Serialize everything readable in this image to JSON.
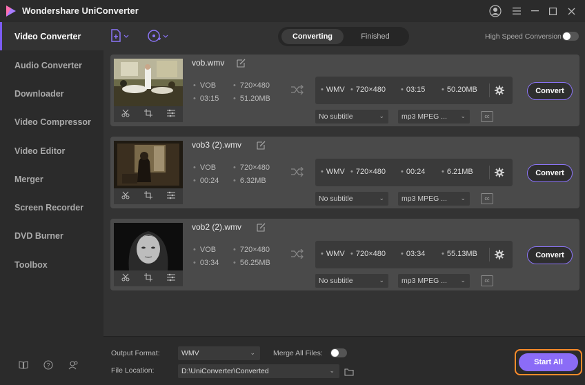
{
  "app": {
    "title": "Wondershare UniConverter"
  },
  "sidebar": {
    "items": [
      {
        "label": "Video Converter",
        "active": true
      },
      {
        "label": "Audio Converter"
      },
      {
        "label": "Downloader"
      },
      {
        "label": "Video Compressor"
      },
      {
        "label": "Video Editor"
      },
      {
        "label": "Merger"
      },
      {
        "label": "Screen Recorder"
      },
      {
        "label": "DVD Burner"
      },
      {
        "label": "Toolbox"
      }
    ]
  },
  "toolbar": {
    "tabs": [
      {
        "label": "Converting",
        "active": true
      },
      {
        "label": "Finished"
      }
    ],
    "high_speed_label": "High Speed Conversion",
    "high_speed_on": false
  },
  "files": [
    {
      "name": "vob.wmv",
      "src_format": "VOB",
      "src_res": "720×480",
      "src_duration": "03:15",
      "src_size": "51.20MB",
      "out_format": "WMV",
      "out_res": "720×480",
      "out_duration": "03:15",
      "out_size": "50.20MB",
      "subtitle": "No subtitle",
      "audio": "mp3 MPEG ...",
      "convert_label": "Convert"
    },
    {
      "name": "vob3 (2).wmv",
      "src_format": "VOB",
      "src_res": "720×480",
      "src_duration": "00:24",
      "src_size": "6.32MB",
      "out_format": "WMV",
      "out_res": "720×480",
      "out_duration": "00:24",
      "out_size": "6.21MB",
      "subtitle": "No subtitle",
      "audio": "mp3 MPEG ...",
      "convert_label": "Convert"
    },
    {
      "name": "vob2 (2).wmv",
      "src_format": "VOB",
      "src_res": "720×480",
      "src_duration": "03:34",
      "src_size": "56.25MB",
      "out_format": "WMV",
      "out_res": "720×480",
      "out_duration": "03:34",
      "out_size": "55.13MB",
      "subtitle": "No subtitle",
      "audio": "mp3 MPEG ...",
      "convert_label": "Convert"
    }
  ],
  "footer": {
    "output_format_label": "Output Format:",
    "output_format": "WMV",
    "merge_label": "Merge All Files:",
    "merge_on": false,
    "location_label": "File Location:",
    "location": "D:\\UniConverter\\Converted",
    "start_all_label": "Start All"
  },
  "colors": {
    "accent": "#8b6cf7",
    "highlight": "#ff8c2a",
    "card_bg": "#4a4a4a"
  }
}
